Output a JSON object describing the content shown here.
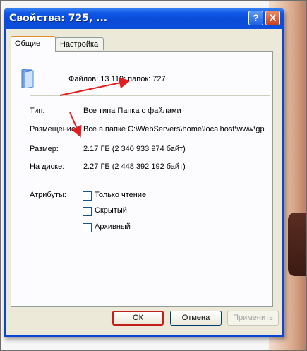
{
  "window": {
    "title": "Свойства: 725, ...",
    "help_glyph": "?",
    "close_glyph": "X"
  },
  "tabs": [
    {
      "label": "Общие",
      "active": true
    },
    {
      "label": "Настройка",
      "active": false
    }
  ],
  "summary": {
    "icon": "folder-icon",
    "text": "Файлов: 13 119; папок: 727"
  },
  "details": [
    {
      "label": "Тип:",
      "value": "Все типа Папка с файлами"
    },
    {
      "label": "Размещение:",
      "value": "Все в папке C:\\WebServers\\home\\localhost\\www\\gp"
    },
    {
      "label": "Размер:",
      "value": "2.17 ГБ (2 340 933 974 байт)"
    },
    {
      "label": "На диске:",
      "value": "2.27 ГБ (2 448 392 192 байт)"
    }
  ],
  "attributes": {
    "label": "Атрибуты:",
    "items": [
      {
        "label": "Только чтение",
        "checked": false
      },
      {
        "label": "Скрытый",
        "checked": false
      },
      {
        "label": "Архивный",
        "checked": false
      }
    ]
  },
  "buttons": {
    "ok": "ОК",
    "cancel": "Отмена",
    "apply": "Применить"
  },
  "colors": {
    "annotation_arrow": "#e02020",
    "title_bar": "#0a4ad6",
    "active_tab_accent": "#e68b2c"
  }
}
